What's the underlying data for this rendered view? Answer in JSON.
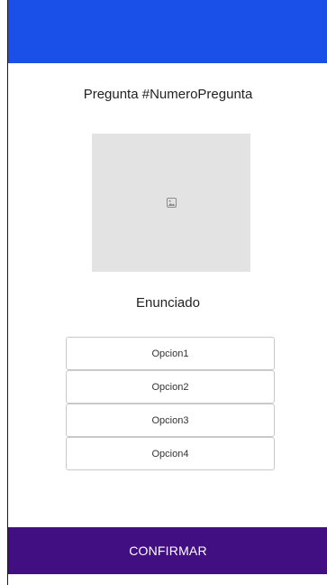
{
  "colors": {
    "top_bar": "#1a4fe8",
    "confirm_bar": "#420f82",
    "placeholder": "#e3e3e3"
  },
  "question": {
    "title": "Pregunta #NumeroPregunta",
    "image_icon": "image-icon",
    "statement": "Enunciado"
  },
  "options": [
    {
      "label": "Opcion1"
    },
    {
      "label": "Opcion2"
    },
    {
      "label": "Opcion3"
    },
    {
      "label": "Opcion4"
    }
  ],
  "footer": {
    "confirm_label": "CONFIRMAR"
  }
}
